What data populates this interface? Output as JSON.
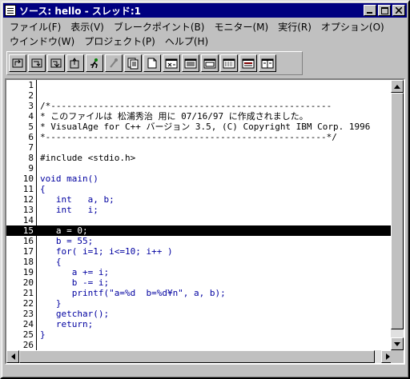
{
  "window": {
    "title": "ソース: hello - スレッド:1"
  },
  "menus": {
    "row1": [
      "ファイル(F)",
      "表示(V)",
      "ブレークポイント(B)",
      "モニター(M)",
      "実行(R)",
      "オプション(O)"
    ],
    "row2": [
      "ウインドウ(W)",
      "プロジェクト(P)",
      "ヘルプ(H)"
    ]
  },
  "toolbar": {
    "icons": [
      "step-over-icon",
      "step-into-icon",
      "step-debug-icon",
      "step-return-icon",
      "run-icon",
      "halt-icon",
      "view-source-icon",
      "view-page-icon",
      "variables-icon",
      "storage-icon",
      "registers-icon",
      "stack-icon",
      "monitor-icon",
      "window-icon"
    ]
  },
  "editor": {
    "highlighted_line": 15,
    "lines": [
      {
        "n": "1",
        "text": ""
      },
      {
        "n": "2",
        "text": ""
      },
      {
        "n": "3",
        "text": "/*-----------------------------------------------------"
      },
      {
        "n": "4",
        "text": "* このファイルは 松浦秀治 用に 07/16/97 に作成されました。"
      },
      {
        "n": "5",
        "text": "* VisualAge for C++ バージョン 3.5, (C) Copyright IBM Corp. 1996"
      },
      {
        "n": "6",
        "text": "*-----------------------------------------------------*/"
      },
      {
        "n": "7",
        "text": ""
      },
      {
        "n": "8",
        "text": "#include <stdio.h>"
      },
      {
        "n": "9",
        "text": ""
      },
      {
        "n": "10",
        "text": "void main()"
      },
      {
        "n": "11",
        "text": "{"
      },
      {
        "n": "12",
        "text": "   int   a, b;"
      },
      {
        "n": "13",
        "text": "   int   i;"
      },
      {
        "n": "14",
        "text": ""
      },
      {
        "n": "15",
        "text": "   a = 0;"
      },
      {
        "n": "16",
        "text": "   b = 55;"
      },
      {
        "n": "17",
        "text": "   for( i=1; i<=10; i++ )"
      },
      {
        "n": "18",
        "text": "   {"
      },
      {
        "n": "19",
        "text": "      a += i;"
      },
      {
        "n": "20",
        "text": "      b -= i;"
      },
      {
        "n": "21",
        "text": "      printf(\"a=%d  b=%d¥n\", a, b);"
      },
      {
        "n": "22",
        "text": "   }"
      },
      {
        "n": "23",
        "text": "   getchar();"
      },
      {
        "n": "24",
        "text": "   return;"
      },
      {
        "n": "25",
        "text": "}"
      },
      {
        "n": "26",
        "text": ""
      }
    ]
  },
  "colors": {
    "code_blue": "#0000a0",
    "comment_black": "#000000",
    "highlight": "#000000"
  }
}
